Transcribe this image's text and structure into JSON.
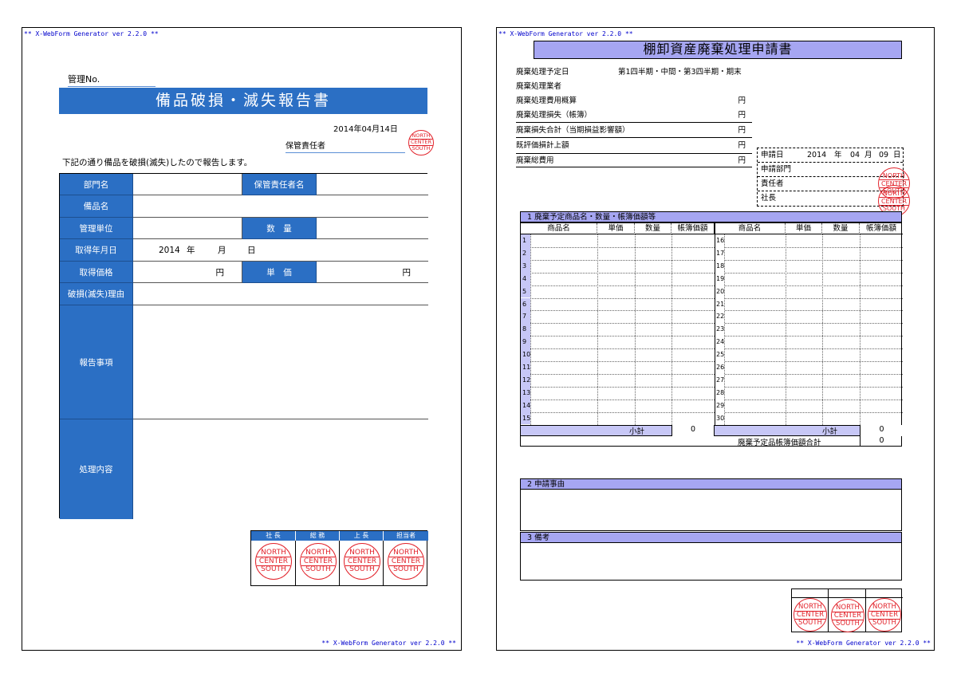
{
  "generator_tag": "** X-WebForm Generator ver 2.2.0 **",
  "stamp": {
    "line1": "NORTH",
    "line2": "CENTER",
    "line3": "SOUTH",
    "color": "#e2242c"
  },
  "accent": {
    "page1_blue": "#2b6fc4",
    "page2_lavender": "#a6a6f2"
  },
  "report": {
    "management_no_label": "管理No.",
    "title": "備品破損・滅失報告書",
    "date": "2014年04月14日",
    "custodian_label": "保管責任者",
    "intro": "下記の通り備品を破損(滅失)したので報告します。",
    "fields": {
      "department": "部門名",
      "custodian_name": "保管責任者名",
      "item_name": "備品名",
      "management_unit": "管理単位",
      "quantity": "数　量",
      "acquisition_date": "取得年月日",
      "acquisition_year": "2014",
      "year_unit": "年",
      "month_unit": "月",
      "day_unit": "日",
      "acquisition_price": "取得価格",
      "yen": "円",
      "unit_price": "単　価",
      "reason": "破損(滅失)理由",
      "report_details": "報告事項",
      "handling": "処理内容"
    },
    "approvals": [
      "社 長",
      "総 務",
      "上 長",
      "担当者"
    ]
  },
  "disposal": {
    "title": "棚卸資産廃棄処理申請書",
    "rows": [
      {
        "label": "廃棄処理予定日",
        "value": "第1四半期・中間・第3四半期・期末",
        "unit": ""
      },
      {
        "label": "廃棄処理業者",
        "value": "",
        "unit": ""
      },
      {
        "label": "廃棄処理費用概算",
        "value": "",
        "unit": "円"
      },
      {
        "label": "廃棄処理損失（帳簿）",
        "value": "",
        "unit": "円"
      },
      {
        "label": "廃棄損失合計（当期損益影響額）",
        "value": "",
        "unit": "円"
      },
      {
        "label": "既評価損計上額",
        "value": "",
        "unit": "円"
      },
      {
        "label": "廃棄総費用",
        "value": "",
        "unit": "円"
      }
    ],
    "application": {
      "date_label": "申請日",
      "year": "2014",
      "year_unit": "年",
      "month": "04",
      "month_unit": "月",
      "day": "09",
      "day_unit": "日",
      "department_label": "申請部門",
      "manager_label": "責任者",
      "president_label": "社長"
    },
    "section1_title": "1 廃棄予定商品名・数量・帳簿価額等",
    "columns": [
      "商品名",
      "単価",
      "数量",
      "帳簿価額"
    ],
    "left_row_numbers": [
      "1",
      "2",
      "3",
      "4",
      "5",
      "6",
      "7",
      "8",
      "9",
      "10",
      "11",
      "12",
      "13",
      "14",
      "15"
    ],
    "right_row_numbers": [
      "16",
      "17",
      "18",
      "19",
      "20",
      "21",
      "22",
      "23",
      "24",
      "25",
      "26",
      "27",
      "28",
      "29",
      "30"
    ],
    "subtotal_label": "小計",
    "subtotal_left": "0",
    "subtotal_right": "0",
    "total_label": "廃棄予定品帳簿価額合計",
    "total_value": "0",
    "section2_title": "2 申請事由",
    "section3_title": "3 備考"
  }
}
